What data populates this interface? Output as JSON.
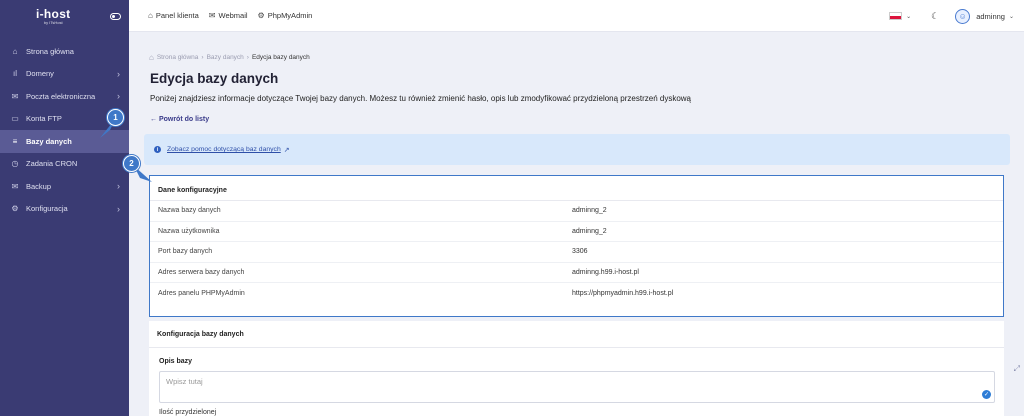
{
  "brand": {
    "name": "i-host",
    "sub": "by ITsHost"
  },
  "sidebar": {
    "items": [
      {
        "label": "Strona główna",
        "icon": "home-icon",
        "glyph": "⌂",
        "has_chevron": false,
        "active": false
      },
      {
        "label": "Domeny",
        "icon": "bar-chart-icon",
        "glyph": "ıl",
        "has_chevron": true,
        "active": false
      },
      {
        "label": "Poczta elektroniczna",
        "icon": "mail-icon",
        "glyph": "✉",
        "has_chevron": true,
        "active": false
      },
      {
        "label": "Konta FTP",
        "icon": "folder-icon",
        "glyph": "▭",
        "has_chevron": false,
        "active": false
      },
      {
        "label": "Bazy danych",
        "icon": "database-icon",
        "glyph": "≡",
        "has_chevron": false,
        "active": true
      },
      {
        "label": "Zadania CRON",
        "icon": "clock-icon",
        "glyph": "◷",
        "has_chevron": false,
        "active": false
      },
      {
        "label": "Backup",
        "icon": "backup-icon",
        "glyph": "✉",
        "has_chevron": true,
        "active": false
      },
      {
        "label": "Konfiguracja",
        "icon": "gear-icon",
        "glyph": "⚙",
        "has_chevron": true,
        "active": false
      }
    ]
  },
  "topbar": {
    "links": [
      {
        "label": "Panel klienta",
        "icon": "home-icon",
        "glyph": "⌂"
      },
      {
        "label": "Webmail",
        "icon": "mail-icon",
        "glyph": "✉"
      },
      {
        "label": "PhpMyAdmin",
        "icon": "gear-icon",
        "glyph": "⚙"
      }
    ],
    "language_flag": "pl",
    "username": "adminng"
  },
  "breadcrumb": {
    "items": [
      "Strona główna",
      "Bazy danych"
    ],
    "current": "Edycja bazy danych"
  },
  "page": {
    "title": "Edycja bazy danych",
    "description": "Poniżej znajdziesz informacje dotyczące Twojej bazy danych. Możesz tu również zmienić hasło, opis lub zmodyfikować przydzieloną przestrzeń dyskową",
    "back_label": "← Powrót do listy"
  },
  "info": {
    "link_text": "Zobacz pomoc dotyczącą baz danych"
  },
  "config": {
    "title": "Dane konfiguracyjne",
    "rows": [
      {
        "key": "Nazwa bazy danych",
        "value": "adminng_2"
      },
      {
        "key": "Nazwa użytkownika",
        "value": "adminng_2"
      },
      {
        "key": "Port bazy danych",
        "value": "3306"
      },
      {
        "key": "Adres serwera bazy danych",
        "value": "adminng.h99.i-host.pl"
      },
      {
        "key": "Adres panelu PHPMyAdmin",
        "value": "https://phpmyadmin.h99.i-host.pl"
      }
    ]
  },
  "db_config": {
    "title": "Konfiguracja bazy danych",
    "description_label": "Opis bazy",
    "description_placeholder": "Wpisz tutaj",
    "next_label_cut": "Ilość przydzielonej"
  },
  "annotations": [
    "1",
    "2"
  ],
  "colors": {
    "sidebar": "#3a3b73",
    "sidebar_active": "#5a5b95",
    "accent": "#3f78c8",
    "info_bg": "#d8e8fb"
  }
}
